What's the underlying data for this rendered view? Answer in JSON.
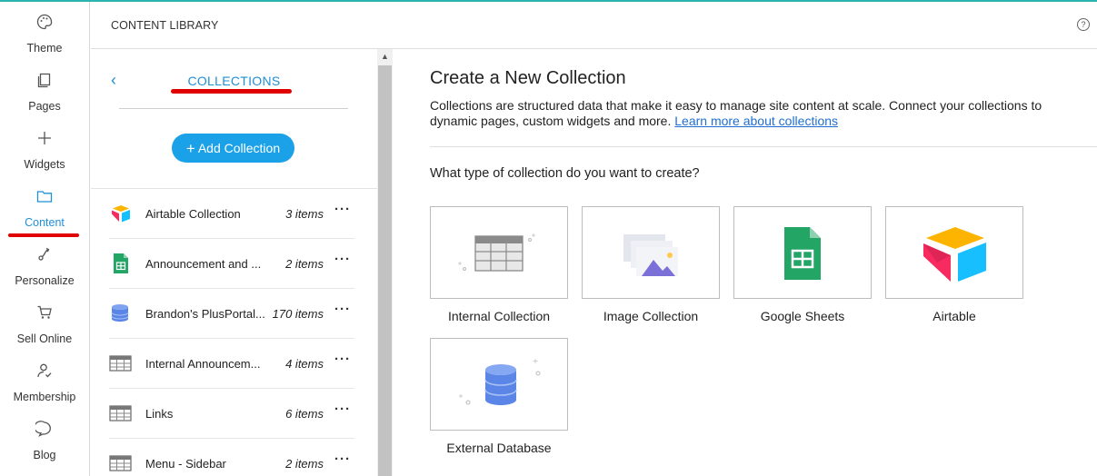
{
  "rail": {
    "items": [
      {
        "label": "Theme",
        "icon": "palette-icon"
      },
      {
        "label": "Pages",
        "icon": "pages-icon"
      },
      {
        "label": "Widgets",
        "icon": "plus-icon"
      },
      {
        "label": "Content",
        "icon": "folder-icon",
        "active": true
      },
      {
        "label": "Personalize",
        "icon": "personalize-icon"
      },
      {
        "label": "Sell Online",
        "icon": "cart-icon"
      },
      {
        "label": "Membership",
        "icon": "member-icon"
      },
      {
        "label": "Blog",
        "icon": "chat-icon"
      }
    ]
  },
  "header": {
    "title": "CONTENT LIBRARY",
    "help": "?"
  },
  "panel": {
    "back": "‹",
    "title": "COLLECTIONS",
    "add_label": "Add Collection",
    "add_plus": "+",
    "collections": [
      {
        "name": "Airtable Collection",
        "count": "3 items",
        "icon": "airtable-icon"
      },
      {
        "name": "Announcement and ...",
        "count": "2 items",
        "icon": "sheets-icon"
      },
      {
        "name": "Brandon's PlusPortal...",
        "count": "170 items",
        "icon": "database-icon"
      },
      {
        "name": "Internal Announcem...",
        "count": "4 items",
        "icon": "table-icon"
      },
      {
        "name": "Links",
        "count": "6 items",
        "icon": "table-icon"
      },
      {
        "name": "Menu - Sidebar",
        "count": "2 items",
        "icon": "table-icon"
      }
    ],
    "more": "···"
  },
  "main": {
    "title": "Create a New Collection",
    "description": "Collections are structured data that make it easy to manage site content at scale. Connect your collections to dynamic pages, custom widgets and more.",
    "learn_more": "Learn more about collections",
    "question": "What type of collection do you want to create?",
    "types": [
      {
        "label": "Internal Collection",
        "icon": "table-icon"
      },
      {
        "label": "Image Collection",
        "icon": "image-icon"
      },
      {
        "label": "Google Sheets",
        "icon": "sheets-icon"
      },
      {
        "label": "Airtable",
        "icon": "airtable-icon"
      },
      {
        "label": "External Database",
        "icon": "database-icon"
      }
    ]
  },
  "colors": {
    "accent": "#1f8fd6",
    "button": "#1aa1e8",
    "highlight": "#e00000",
    "top_line": "#2bb3b1"
  }
}
